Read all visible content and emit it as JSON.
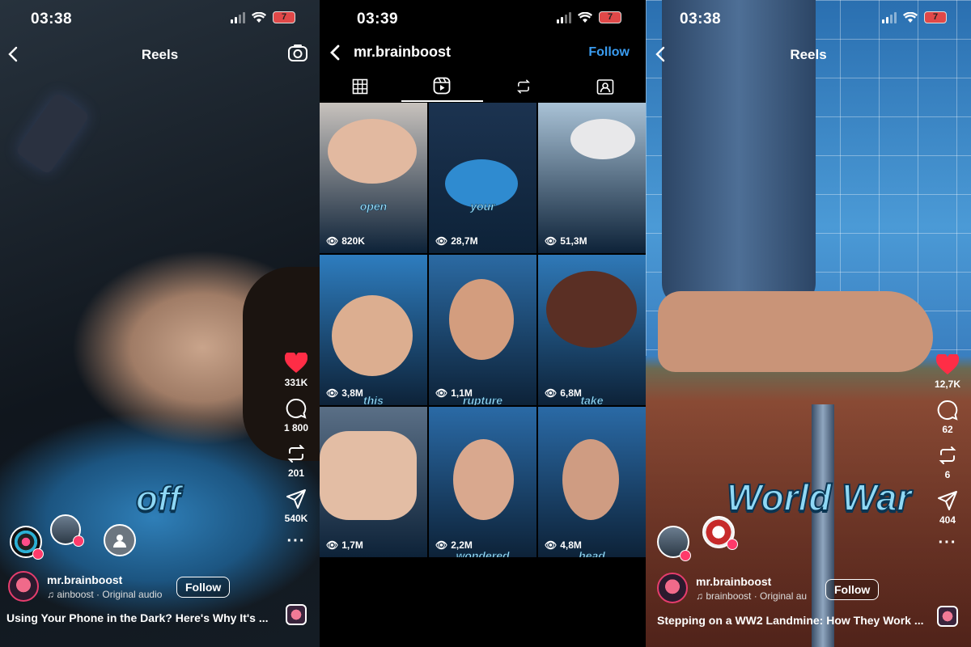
{
  "left_reel": {
    "time": "03:38",
    "battery": "7",
    "title": "Reels",
    "overlay_word": "off",
    "likes": "331K",
    "comments": "1 800",
    "reposts": "201",
    "shares": "540K",
    "username": "mr.brainboost",
    "audio": "ainboost · Original audio",
    "follow_label": "Follow",
    "caption": "Using Your Phone in the Dark? Here's Why It's ..."
  },
  "profile": {
    "time": "03:39",
    "battery": "7",
    "username": "mr.brainboost",
    "follow_label": "Follow",
    "tabs": [
      "grid",
      "reels",
      "reposts",
      "tagged"
    ],
    "reels": [
      {
        "caption": "open",
        "views": "820K",
        "bg": "#c8c2bd"
      },
      {
        "caption": "your",
        "views": "28,7M",
        "bg": "#1c3350"
      },
      {
        "caption": "",
        "views": "51,3M",
        "bg": "#a9c2d6"
      },
      {
        "caption": "this",
        "views": "3,8M",
        "bg": "#2e7dbf"
      },
      {
        "caption": "rupture",
        "views": "1,1M",
        "bg": "#2b6aa3"
      },
      {
        "caption": "take",
        "views": "6,8M",
        "bg": "#2f79b8"
      },
      {
        "caption": "",
        "views": "1,7M",
        "bg": "#5a6f86"
      },
      {
        "caption": "wondered",
        "views": "2,2M",
        "bg": "#2a6aa6"
      },
      {
        "caption": "head",
        "views": "4,8M",
        "bg": "#2a6aa6"
      }
    ]
  },
  "right_reel": {
    "time": "03:38",
    "battery": "7",
    "title": "Reels",
    "overlay_word": "World War",
    "likes": "12,7K",
    "comments": "62",
    "reposts": "6",
    "shares": "404",
    "username": "mr.brainboost",
    "audio": "brainboost · Original au",
    "follow_label": "Follow",
    "caption": "Stepping on a WW2 Landmine: How They Work ..."
  },
  "colors": {
    "like_red": "#ff2d46",
    "follow_blue": "#3a9cf0",
    "caption_cyan": "#8fd8f5"
  }
}
